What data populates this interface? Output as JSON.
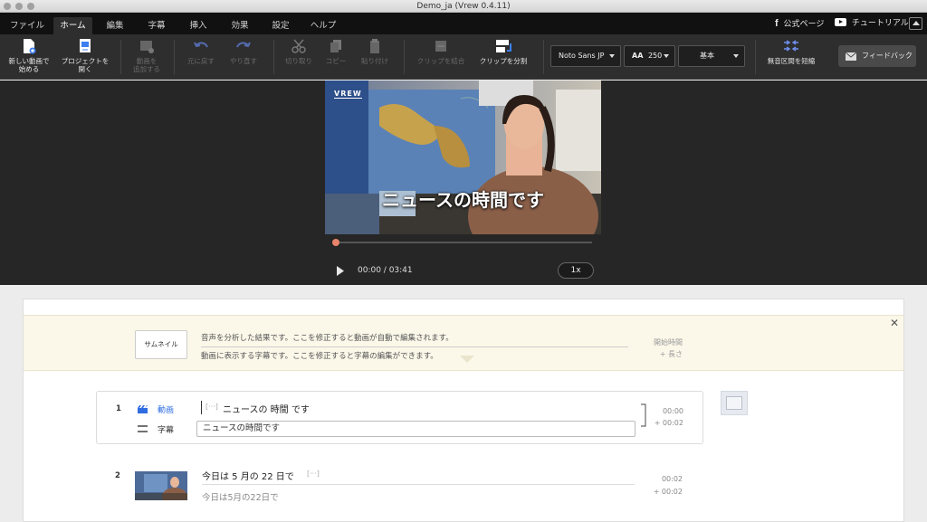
{
  "window": {
    "title": "Demo_ja (Vrew 0.4.11)"
  },
  "menu": {
    "tabs": [
      {
        "label": "ファイル"
      },
      {
        "label": "ホーム",
        "active": true
      },
      {
        "label": "編集"
      },
      {
        "label": "字幕"
      },
      {
        "label": "挿入"
      },
      {
        "label": "効果"
      },
      {
        "label": "設定"
      },
      {
        "label": "ヘルプ"
      }
    ],
    "facebook_label": "公式ページ",
    "youtube_label": "チュートリアル"
  },
  "toolbar": {
    "new_video": "新しい動画で\n始める",
    "open_project": "プロジェクトを\n開く",
    "add_video": "動画を\n追加する",
    "undo": "元に戻す",
    "redo": "やり直す",
    "cut": "切り取り",
    "copy": "コピー",
    "paste": "貼り付け",
    "merge_clip": "クリップを結合",
    "split_clip": "クリップを分割",
    "font": "Noto Sans JP",
    "font_size": "250",
    "style": "基本",
    "shorten_silence": "無音区間を短縮",
    "feedback": "フィードバック"
  },
  "player": {
    "subtitle": "ニュースの時間です",
    "watermark": "VREW",
    "time": "00:00 / 03:41",
    "speed": "1x",
    "progress": 0.01
  },
  "guide": {
    "thumbnail_button": "サムネイル",
    "line1": "音声を分析した結果です。ここを修正すると動画が自動で編集されます。",
    "line2": "動画に表示する字幕です。ここを修正すると字幕の編集ができます。",
    "start_time": "開始時間",
    "length": "+ 長さ",
    "close": "✕"
  },
  "clips": [
    {
      "number": "1",
      "video_label": "動画",
      "subtitle_label": "字幕",
      "ellipsis": "[···]",
      "words": "ニュースの  時間  です",
      "subtitle": "ニュースの時間です",
      "start": "00:00",
      "length": "+  00:02"
    },
    {
      "number": "2",
      "ellipsis": "[···]",
      "words": "今日は  5  月の  22  日で",
      "subtitle": "今日は5月の22日で",
      "start": "00:02",
      "length": "+  00:02"
    }
  ],
  "colors": {
    "accent_blue": "#2f6de1",
    "progress_knob": "#e8846a"
  }
}
